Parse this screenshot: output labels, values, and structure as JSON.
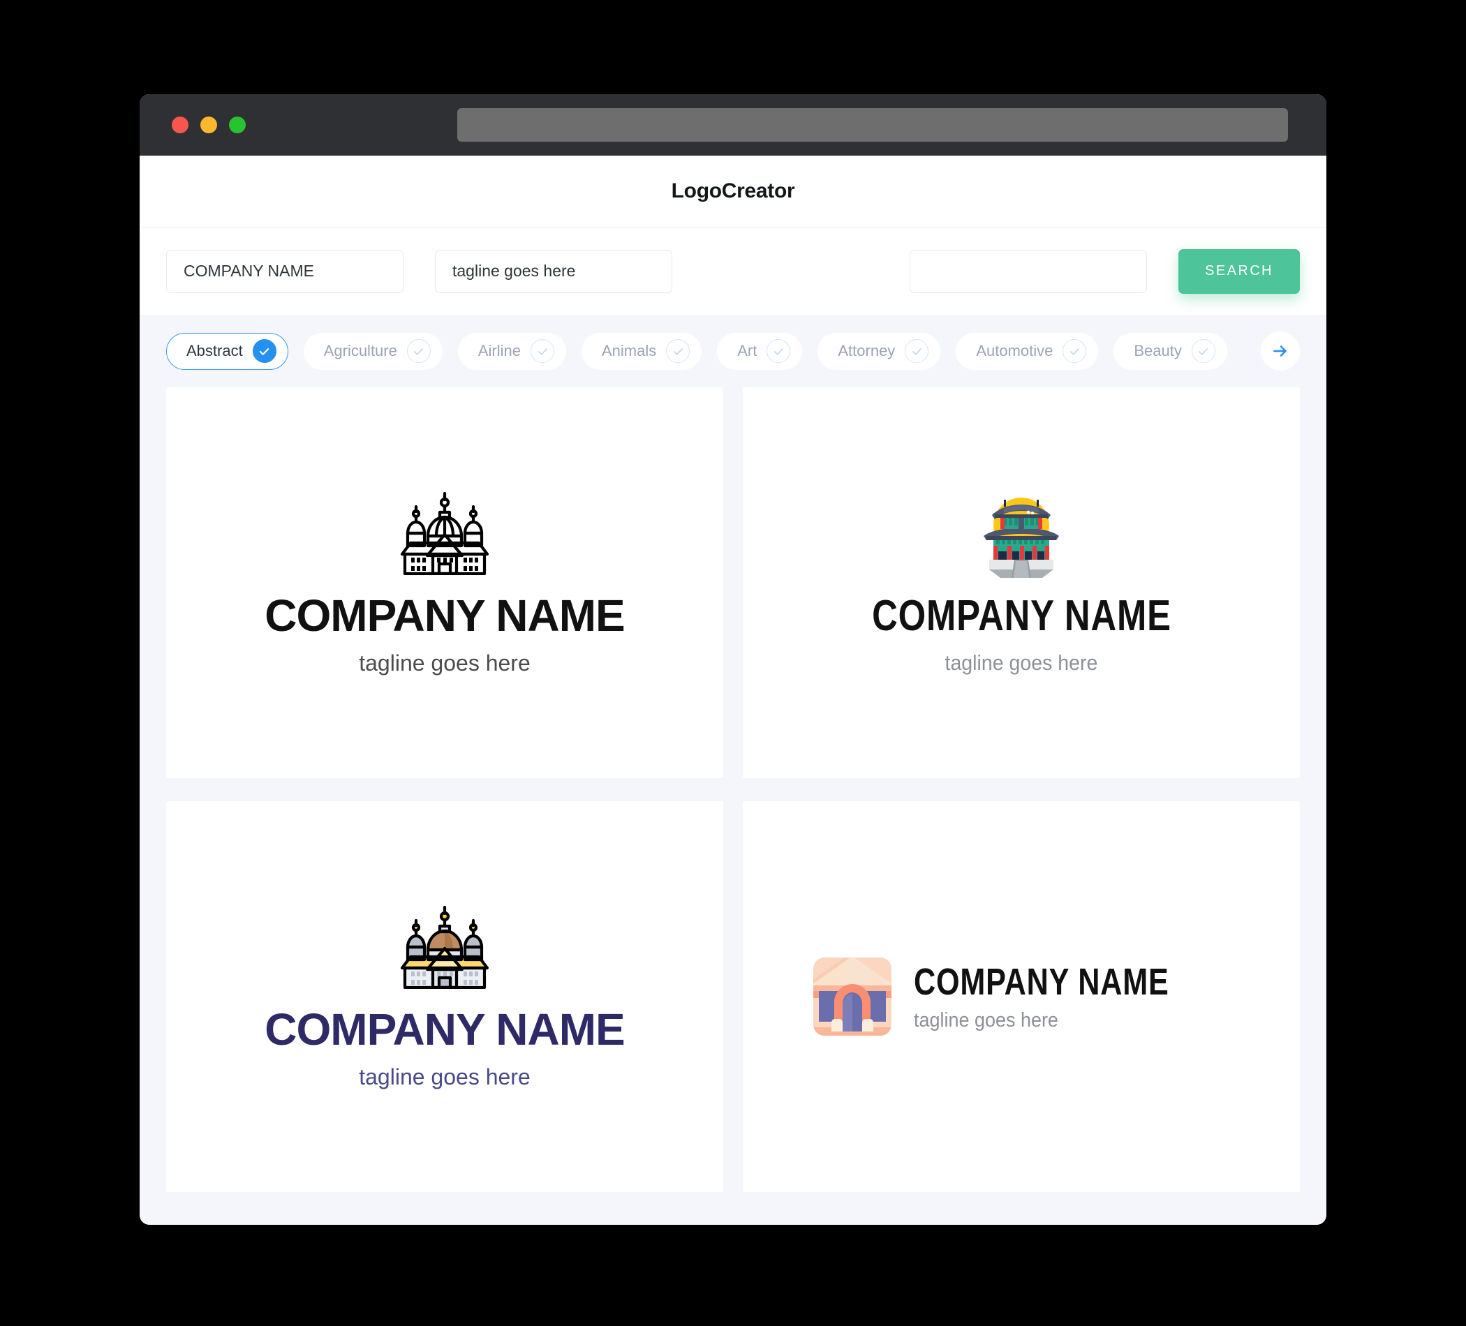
{
  "window": {
    "titlebar": {
      "traffic_lights": [
        "close",
        "minimize",
        "maximize"
      ],
      "url_value": ""
    }
  },
  "header": {
    "title": "LogoCreator"
  },
  "search": {
    "company_name_value": "COMPANY NAME",
    "tagline_value": "tagline goes here",
    "keyword_value": "",
    "keyword_placeholder": "",
    "search_button_label": "SEARCH"
  },
  "categories": {
    "next_icon": "arrow-right-icon",
    "items": [
      {
        "label": "Abstract",
        "selected": true
      },
      {
        "label": "Agriculture",
        "selected": false
      },
      {
        "label": "Airline",
        "selected": false
      },
      {
        "label": "Animals",
        "selected": false
      },
      {
        "label": "Art",
        "selected": false
      },
      {
        "label": "Attorney",
        "selected": false
      },
      {
        "label": "Automotive",
        "selected": false
      },
      {
        "label": "Beauty",
        "selected": false
      }
    ]
  },
  "results": {
    "cards": [
      {
        "icon": "cathedral-outline-icon",
        "name": "COMPANY NAME",
        "tagline": "tagline goes here",
        "name_color": "#111111",
        "tagline_color": "#4c4c4c",
        "layout": "vertical"
      },
      {
        "icon": "korean-palace-icon",
        "name": "COMPANY NAME",
        "tagline": "tagline goes here",
        "name_color": "#111111",
        "tagline_color": "#8d9096",
        "layout": "vertical"
      },
      {
        "icon": "cathedral-color-icon",
        "name": "COMPANY NAME",
        "tagline": "tagline goes here",
        "name_color": "#2e2a66",
        "tagline_color": "#4a4a8a",
        "layout": "vertical"
      },
      {
        "icon": "arch-building-icon",
        "name": "COMPANY NAME",
        "tagline": "tagline goes here",
        "name_color": "#111111",
        "tagline_color": "#8d9096",
        "layout": "horizontal"
      }
    ]
  },
  "colors": {
    "accent_green": "#4ec49a",
    "accent_blue": "#2490f0",
    "page_background": "#f4f6fc",
    "titlebar": "#2f3033"
  }
}
